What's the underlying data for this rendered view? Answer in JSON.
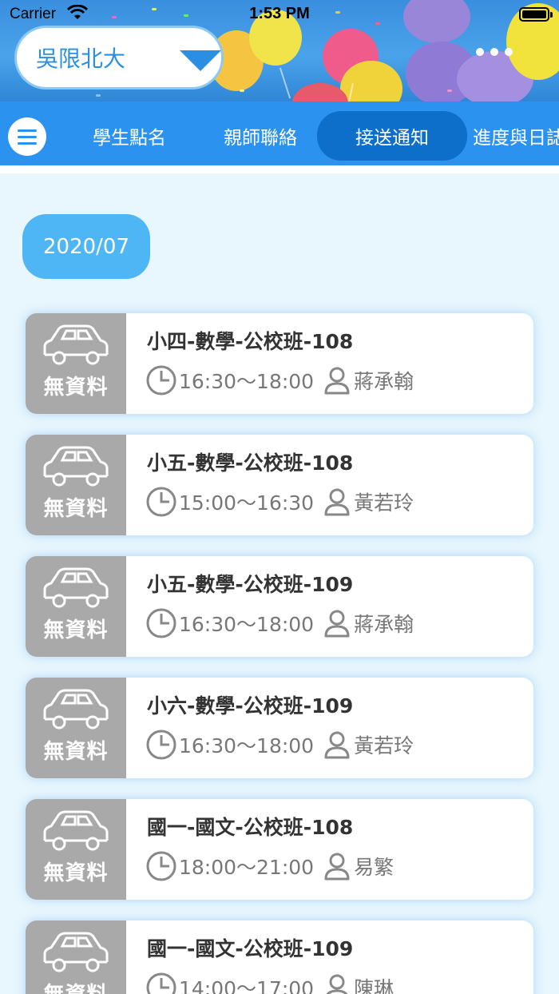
{
  "status_bar": {
    "carrier": "Carrier",
    "time": "1:53 PM"
  },
  "header": {
    "school": "吳限北大"
  },
  "tabs": [
    {
      "label": "學生點名",
      "active": false
    },
    {
      "label": "親師聯絡",
      "active": false
    },
    {
      "label": "接送通知",
      "active": true
    },
    {
      "label": "進度與日誌",
      "active": false
    }
  ],
  "month": "2020/07",
  "no_data_label": "無資料",
  "records": [
    {
      "course": "小四-數學-公校班-108",
      "time": "16:30～18:00",
      "teacher": "蔣承翰"
    },
    {
      "course": "小五-數學-公校班-108",
      "time": "15:00～16:30",
      "teacher": "黃若玲"
    },
    {
      "course": "小五-數學-公校班-109",
      "time": "16:30～18:00",
      "teacher": "蔣承翰"
    },
    {
      "course": "小六-數學-公校班-109",
      "time": "16:30～18:00",
      "teacher": "黃若玲"
    },
    {
      "course": "國一-國文-公校班-108",
      "time": "18:00～21:00",
      "teacher": "易繁"
    },
    {
      "course": "國一-國文-公校班-109",
      "time": "14:00～17:00",
      "teacher": "陳琳"
    }
  ],
  "colors": {
    "accent": "#2b93ef",
    "active_tab": "#0d6fc9",
    "chip": "#4fb6f5",
    "card_side": "#a9a9a9"
  }
}
